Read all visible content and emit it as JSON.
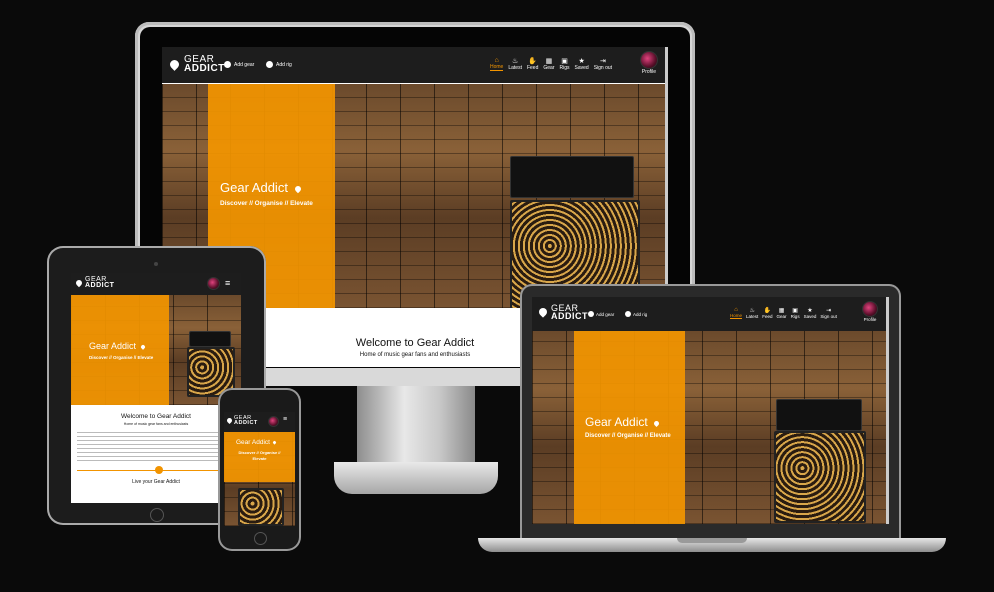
{
  "site": {
    "logo_top": "GEAR",
    "logo_bottom": "ADDICT",
    "title": "Gear Addict",
    "tagline": "Discover // Organise // Elevate",
    "welcome_title": "Welcome to Gear Addict",
    "welcome_sub": "Home of music gear fans and enthusiasts"
  },
  "nav": {
    "add_gear": "Add gear",
    "add_rig": "Add rig",
    "items": [
      {
        "label": "Home",
        "icon": "home-icon",
        "glyph": "⌂"
      },
      {
        "label": "Latest",
        "icon": "fire-icon",
        "glyph": "♨"
      },
      {
        "label": "Feed",
        "icon": "feed-icon",
        "glyph": "✋"
      },
      {
        "label": "Gear",
        "icon": "gear-icon",
        "glyph": "▦"
      },
      {
        "label": "Rigs",
        "icon": "rigs-icon",
        "glyph": "▣"
      },
      {
        "label": "Saved",
        "icon": "star-icon",
        "glyph": "★"
      },
      {
        "label": "Sign out",
        "icon": "sign-out-icon",
        "glyph": "⇥"
      }
    ],
    "profile": "Profile",
    "menu_glyph": "≡"
  },
  "tablet_body": {
    "heading": "Live your Gear Addict"
  },
  "colors": {
    "accent": "#f29400",
    "navbar": "#1d1d1d"
  }
}
